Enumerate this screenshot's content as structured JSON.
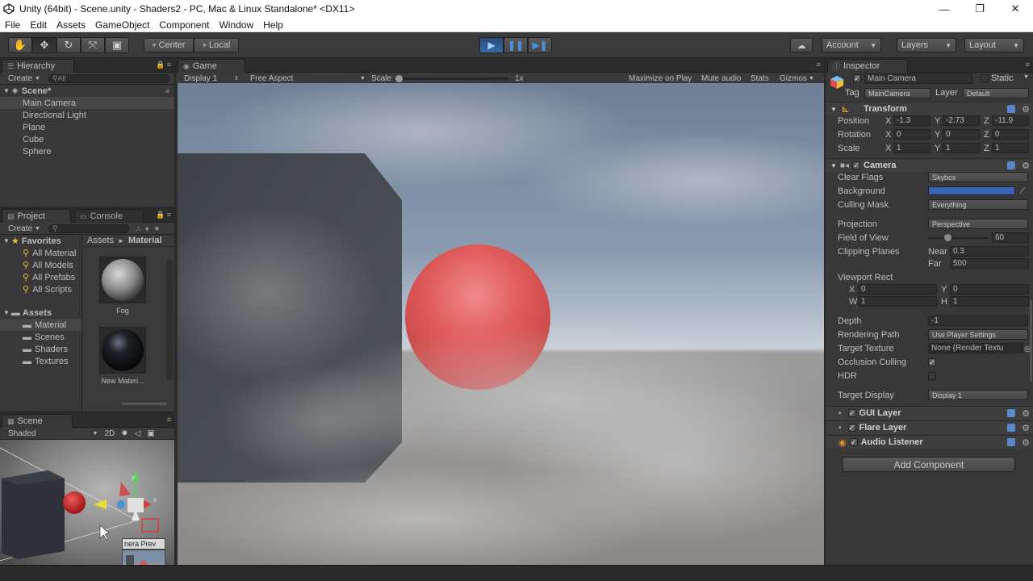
{
  "window": {
    "title": "Unity (64bit) - Scene.unity - Shaders2 - PC, Mac & Linux Standalone* <DX11>",
    "controls": [
      "—",
      "❐",
      "✕"
    ]
  },
  "menu": [
    "File",
    "Edit",
    "Assets",
    "GameObject",
    "Component",
    "Window",
    "Help"
  ],
  "toolbar": {
    "tools": [
      "✋",
      "✥",
      "↻",
      "⤧",
      "▣"
    ],
    "pivot": "Center",
    "space": "Local",
    "play": [
      "▶",
      "❚❚",
      "▶❚"
    ],
    "account": "Account",
    "layers": "Layers",
    "layout": "Layout",
    "cloud_icon": "☁"
  },
  "hierarchy": {
    "tab": "Hierarchy",
    "create": "Create",
    "search_placeholder": "All",
    "scene": "Scene*",
    "items": [
      "Main Camera",
      "Directional Light",
      "Plane",
      "Cube",
      "Sphere"
    ]
  },
  "project": {
    "tab_project": "Project",
    "tab_console": "Console",
    "create": "Create",
    "favorites": "Favorites",
    "favorite_items": [
      "All Material",
      "All Models",
      "All Prefabs",
      "All Scripts"
    ],
    "assets": "Assets",
    "asset_folders": [
      "Material",
      "Scenes",
      "Shaders",
      "Textures"
    ],
    "breadcrumb_root": "Assets",
    "breadcrumb_sep": "►",
    "breadcrumb_current": "Material",
    "materials": [
      "Fog",
      "New Materi..."
    ]
  },
  "scene": {
    "tab": "Scene",
    "shading": "Shaded",
    "mode_2d": "2D",
    "camera_preview": "nera Prev",
    "axis_y": "y",
    "axis_x": "x"
  },
  "game": {
    "tab": "Game",
    "display": "Display 1",
    "aspect": "Free Aspect",
    "scale_label": "Scale",
    "scale_value": "1x",
    "options": [
      "Maximize on Play",
      "Mute audio",
      "Stats",
      "Gizmos"
    ]
  },
  "inspector": {
    "tab": "Inspector",
    "object_name": "Main Camera",
    "static": "Static",
    "tag_label": "Tag",
    "tag_value": "MainCamera",
    "layer_label": "Layer",
    "layer_value": "Default",
    "transform": {
      "title": "Transform",
      "position": {
        "label": "Position",
        "x": "-1.3",
        "y": "-2.73",
        "z": "-11.9"
      },
      "rotation": {
        "label": "Rotation",
        "x": "0",
        "y": "0",
        "z": "0"
      },
      "scale": {
        "label": "Scale",
        "x": "1",
        "y": "1",
        "z": "1"
      },
      "axis_x": "X",
      "axis_y": "Y",
      "axis_z": "Z"
    },
    "camera": {
      "title": "Camera",
      "clear_flags_label": "Clear Flags",
      "clear_flags": "Skybox",
      "background_label": "Background",
      "background_color": "#3a64b8",
      "culling_mask_label": "Culling Mask",
      "culling_mask": "Everything",
      "projection_label": "Projection",
      "projection": "Perspective",
      "fov_label": "Field of View",
      "fov": "60",
      "clipping_label": "Clipping Planes",
      "near_label": "Near",
      "near": "0.3",
      "far_label": "Far",
      "far": "500",
      "viewport_label": "Viewport Rect",
      "vp_x_label": "X",
      "vp_x": "0",
      "vp_y_label": "Y",
      "vp_y": "0",
      "vp_w_label": "W",
      "vp_w": "1",
      "vp_h_label": "H",
      "vp_h": "1",
      "depth_label": "Depth",
      "depth": "-1",
      "rendering_path_label": "Rendering Path",
      "rendering_path": "Use Player Settings",
      "target_texture_label": "Target Texture",
      "target_texture": "None (Render Textu",
      "occlusion_label": "Occlusion Culling",
      "hdr_label": "HDR",
      "target_display_label": "Target Display",
      "target_display": "Display 1"
    },
    "components": [
      "GUI Layer",
      "Flare Layer",
      "Audio Listener"
    ],
    "add_component": "Add Component"
  }
}
